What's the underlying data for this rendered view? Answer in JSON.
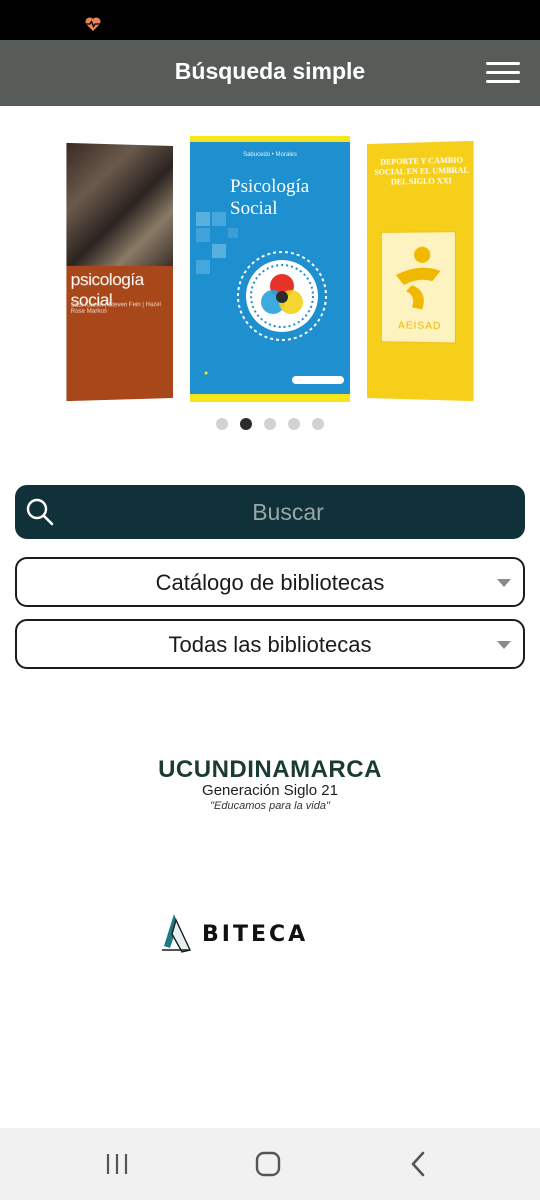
{
  "status_bar": {
    "icon": "heart-pulse-icon"
  },
  "app_bar": {
    "title": "Búsqueda simple",
    "menu_icon": "hamburger-menu-icon"
  },
  "carousel": {
    "covers": [
      {
        "title": "psicología social",
        "authors": "Saul Kassin | Steven Fein | Hazel Rose Markus"
      },
      {
        "title_line1": "Psicología",
        "title_line2": "Social",
        "authors": "Sabucedo • Morales"
      },
      {
        "title": "DEPORTE Y CAMBIO SOCIAL EN EL UMBRAL DEL SIGLO XXI",
        "brand": "AEISAD"
      }
    ],
    "dots_total": 5,
    "active_dot": 2
  },
  "search": {
    "placeholder": "Buscar",
    "icon": "search-icon"
  },
  "selects": {
    "catalog": "Catálogo de bibliotecas",
    "library": "Todas las bibliotecas"
  },
  "logos": {
    "ucundinamarca": {
      "name": "UCUNDINAMARCA",
      "tagline": "Generación Siglo 21",
      "motto": "\"Educamos para la vida\""
    },
    "biteca": {
      "name": "BITECA"
    }
  },
  "nav_bar": {
    "recents_icon": "recents-icon",
    "home_icon": "home-icon",
    "back_icon": "back-icon"
  }
}
